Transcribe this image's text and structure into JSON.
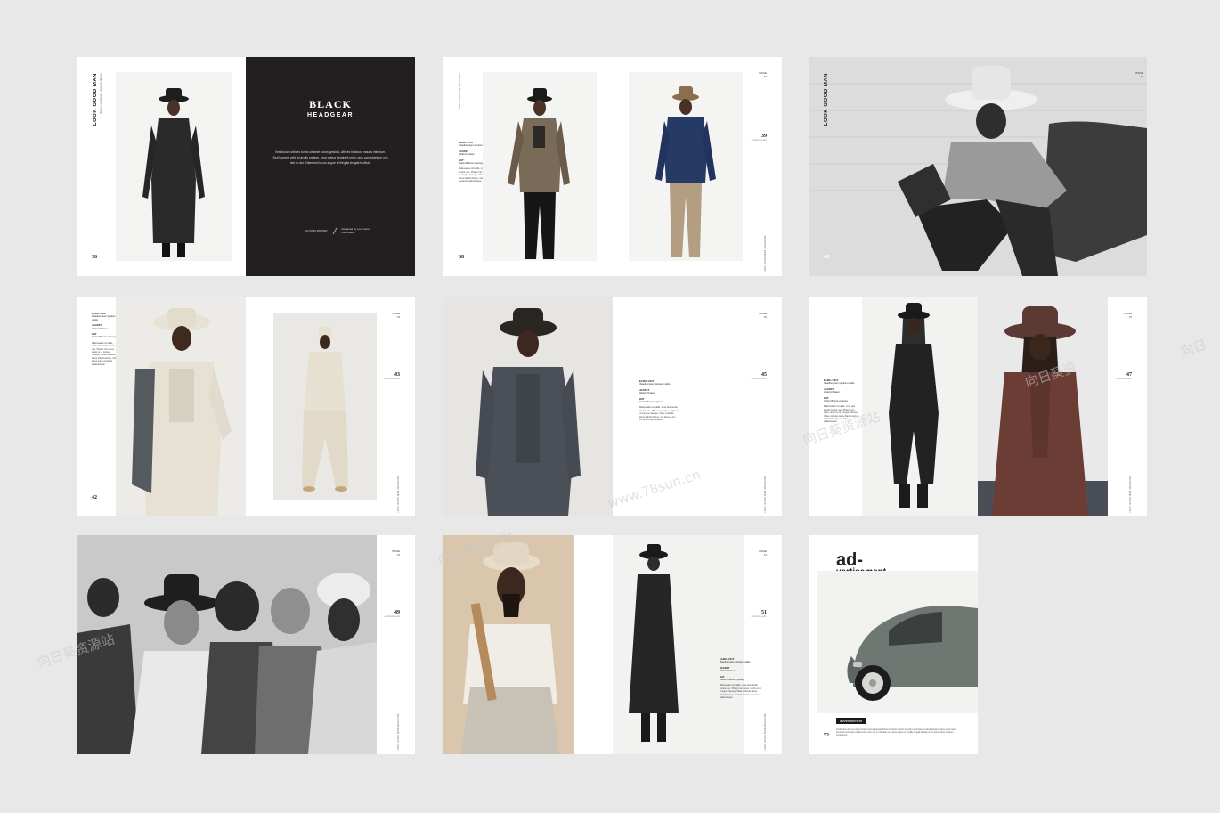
{
  "brand": "LOOK GOOD MAN",
  "brand_sub": "Men's Lookbook · Autumn Winter",
  "issue": [
    "ISSUE",
    "72"
  ],
  "spine": "LOOK GOOD MAN MAGAZINE",
  "caption": {
    "coat_h": "ELMA / 2017",
    "coat_t": "Vitaellus ipsum pretium mattis",
    "jacket_h": "JACKET",
    "jacket_t": "Abdel Al Fraser",
    "hat_h": "HAT",
    "hat_t": "Cotton Brauns of jersey",
    "para": "Malesuada convallis, urna sed iaculis ornare nec. Pharet rum quos, turpis et ut congue Vesupe. Vitae molestie lacus blandit lectus, nisi lacus enim vel amet pellentesque."
  },
  "p36": "36",
  "p38": "38",
  "p39": "39",
  "p40": "40",
  "p42": "42",
  "p43": "43",
  "p45": "45",
  "p47": "47",
  "p49": "49",
  "p51": "51",
  "p52": "52",
  "num_sub": "ANNIVERSARY",
  "bh": {
    "t1": "BLACK",
    "t2": "HEADGEAR",
    "body": "Vestibulum ultrices turpis sit amet purus gravida, ultrices tincidunt mauris interdum. Sed laoreet, velit at iaculis pretium, urna metus hendrerit enim, quis condimentum orci nisi ut nisl. Etiam sed lacus augue et fringilla feugiat facilisis.",
    "foot1": "AUTUMN WINTER",
    "foot2": "Designed by Look Good Man Atelier"
  },
  "ad": {
    "a1": "ad-",
    "a2": "vertisement",
    "label": "advertisement",
    "text": "Vestibulum ultrices turpis sit amet purus gravida ultrices tincidunt mauris interdum sed laoreet velit at iaculis pretium urna metus hendrerit enim quis condimentum orci nisi ut nisl etiam sed lacus augue et fringilla feugiat facilisis lorem ipsum dolor sit amet consectetur."
  },
  "watermark": [
    "向日葵资源站",
    "www.78sun.cn",
    "向日葵资源站",
    "向日葵资源站",
    "向日葵资",
    "向日"
  ],
  "colors": {
    "background": "#e8e8e8",
    "page": "#ffffff",
    "dark_page": "#231f20",
    "accent_brown": "#6b3d35"
  }
}
